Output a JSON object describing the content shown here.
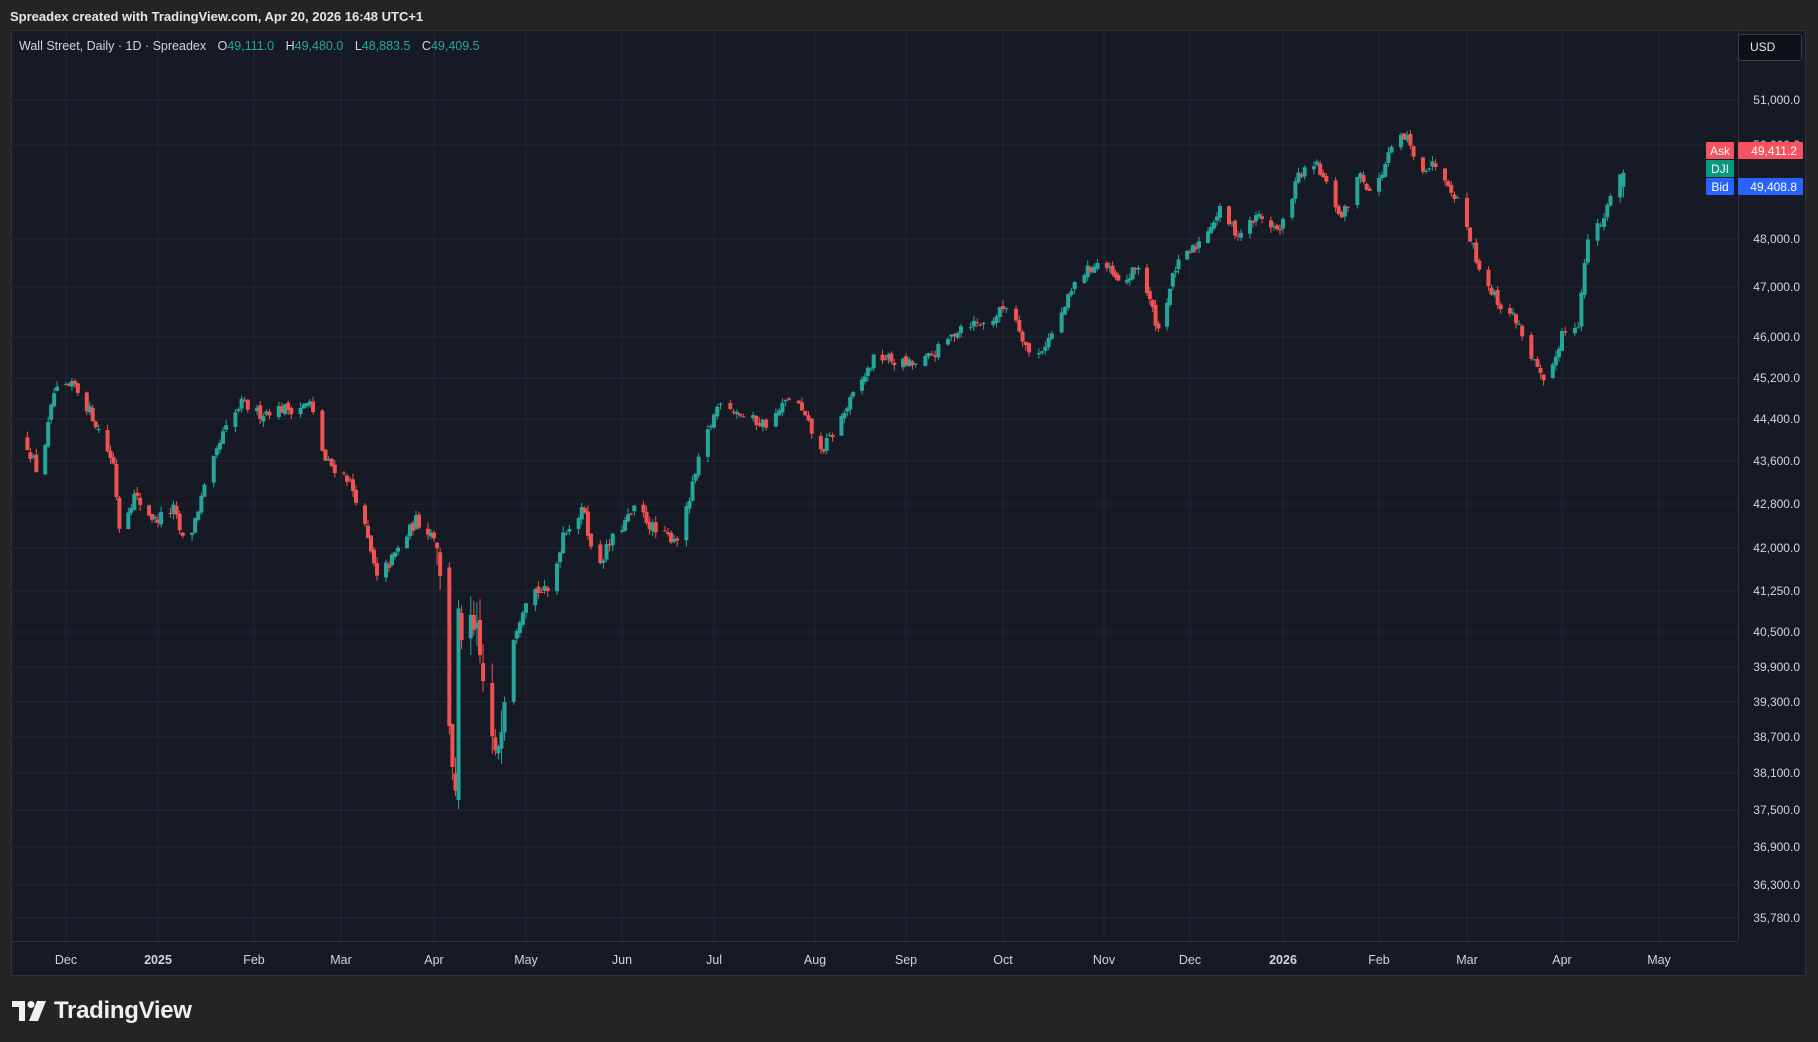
{
  "header": {
    "attribution": "Spreadex created with TradingView.com, Apr 20, 2026 16:48 UTC+1"
  },
  "legend": {
    "symbol": "Wall Street, Daily · 1D · Spreadex",
    "o_label": "O",
    "o_value": "49,111.0",
    "h_label": "H",
    "h_value": "49,480.0",
    "l_label": "L",
    "l_value": "48,883.5",
    "c_label": "C",
    "c_value": "49,409.5"
  },
  "currency": "USD",
  "footer": {
    "logo_text": "TradingView"
  },
  "colors": {
    "up": "#26a69a",
    "down": "#ef5350",
    "background": "#161a25",
    "grid": "#222633",
    "ask": "#f7525f",
    "bid": "#2962ff"
  },
  "chart_data": {
    "type": "candlestick",
    "price_labels": [
      {
        "label": "Ask",
        "value": "49,411.2",
        "color": "#f7525f"
      },
      {
        "label": "DJI",
        "value": "",
        "color": "#089981"
      },
      {
        "label": "Bid",
        "value": "49,408.8",
        "color": "#2962ff"
      }
    ],
    "y_ticks": [
      {
        "v": 51000,
        "t": "51,000.0"
      },
      {
        "v": 50000,
        "t": "50,000.0"
      },
      {
        "v": 48000,
        "t": "48,000.0"
      },
      {
        "v": 47000,
        "t": "47,000.0"
      },
      {
        "v": 46000,
        "t": "46,000.0"
      },
      {
        "v": 45200,
        "t": "45,200.0"
      },
      {
        "v": 44400,
        "t": "44,400.0"
      },
      {
        "v": 43600,
        "t": "43,600.0"
      },
      {
        "v": 42800,
        "t": "42,800.0"
      },
      {
        "v": 42000,
        "t": "42,000.0"
      },
      {
        "v": 41250,
        "t": "41,250.0"
      },
      {
        "v": 40500,
        "t": "40,500.0"
      },
      {
        "v": 39900,
        "t": "39,900.0"
      },
      {
        "v": 39300,
        "t": "39,300.0"
      },
      {
        "v": 38700,
        "t": "38,700.0"
      },
      {
        "v": 38100,
        "t": "38,100.0"
      },
      {
        "v": 37500,
        "t": "37,500.0"
      },
      {
        "v": 36900,
        "t": "36,900.0"
      },
      {
        "v": 36300,
        "t": "36,300.0"
      },
      {
        "v": 35780,
        "t": "35,780.0"
      }
    ],
    "x_ticks": [
      {
        "date": "2024-12-01",
        "t": "Dec",
        "bold": false
      },
      {
        "date": "2025-01-01",
        "t": "2025",
        "bold": true
      },
      {
        "date": "2025-02-01",
        "t": "Feb",
        "bold": false
      },
      {
        "date": "2025-03-01",
        "t": "Mar",
        "bold": false
      },
      {
        "date": "2025-04-01",
        "t": "Apr",
        "bold": false
      },
      {
        "date": "2025-05-01",
        "t": "May",
        "bold": false
      },
      {
        "date": "2025-06-01",
        "t": "Jun",
        "bold": false
      },
      {
        "date": "2025-07-01",
        "t": "Jul",
        "bold": false
      },
      {
        "date": "2025-08-01",
        "t": "Aug",
        "bold": false
      },
      {
        "date": "2025-09-01",
        "t": "Sep",
        "bold": false
      },
      {
        "date": "2025-10-01",
        "t": "Oct",
        "bold": false
      },
      {
        "date": "2025-11-01",
        "t": "Nov",
        "bold": false
      },
      {
        "date": "2025-12-01",
        "t": "Dec",
        "bold": false
      },
      {
        "date": "2026-01-01",
        "t": "2026",
        "bold": true
      },
      {
        "date": "2026-02-01",
        "t": "Feb",
        "bold": false
      },
      {
        "date": "2026-03-01",
        "t": "Mar",
        "bold": false
      },
      {
        "date": "2026-04-01",
        "t": "Apr",
        "bold": false
      },
      {
        "date": "2026-05-01",
        "t": "May",
        "bold": false
      }
    ],
    "close_path": [
      [
        "2024-11-18",
        43900
      ],
      [
        "2024-11-22",
        43300
      ],
      [
        "2024-11-27",
        44900
      ],
      [
        "2024-12-04",
        45050
      ],
      [
        "2024-12-10",
        44450
      ],
      [
        "2024-12-17",
        43550
      ],
      [
        "2024-12-19",
        42400
      ],
      [
        "2024-12-24",
        42950
      ],
      [
        "2024-12-31",
        42500
      ],
      [
        "2025-01-06",
        42700
      ],
      [
        "2025-01-10",
        41950
      ],
      [
        "2025-01-15",
        42900
      ],
      [
        "2025-01-22",
        44100
      ],
      [
        "2025-01-28",
        44700
      ],
      [
        "2025-02-03",
        44500
      ],
      [
        "2025-02-07",
        44600
      ],
      [
        "2025-02-14",
        44600
      ],
      [
        "2025-02-19",
        44700
      ],
      [
        "2025-02-24",
        43600
      ],
      [
        "2025-03-03",
        43300
      ],
      [
        "2025-03-07",
        42800
      ],
      [
        "2025-03-13",
        41450
      ],
      [
        "2025-03-18",
        41800
      ],
      [
        "2025-03-26",
        42500
      ],
      [
        "2025-04-02",
        42200
      ],
      [
        "2025-04-04",
        40550
      ],
      [
        "2025-04-08",
        37600
      ],
      [
        "2025-04-09",
        40600
      ],
      [
        "2025-04-15",
        40350
      ],
      [
        "2025-04-21",
        38200
      ],
      [
        "2025-04-25",
        40100
      ],
      [
        "2025-05-02",
        41300
      ],
      [
        "2025-05-09",
        41200
      ],
      [
        "2025-05-13",
        42300
      ],
      [
        "2025-05-20",
        42700
      ],
      [
        "2025-05-23",
        41600
      ],
      [
        "2025-05-30",
        42250
      ],
      [
        "2025-06-06",
        42750
      ],
      [
        "2025-06-13",
        42200
      ],
      [
        "2025-06-20",
        42200
      ],
      [
        "2025-06-27",
        43800
      ],
      [
        "2025-07-03",
        44800
      ],
      [
        "2025-07-11",
        44400
      ],
      [
        "2025-07-18",
        44300
      ],
      [
        "2025-07-25",
        44900
      ],
      [
        "2025-07-31",
        44150
      ],
      [
        "2025-08-01",
        43600
      ],
      [
        "2025-08-08",
        44200
      ],
      [
        "2025-08-15",
        44950
      ],
      [
        "2025-08-22",
        45650
      ],
      [
        "2025-08-29",
        45500
      ],
      [
        "2025-09-05",
        45450
      ],
      [
        "2025-09-12",
        45800
      ],
      [
        "2025-09-19",
        46300
      ],
      [
        "2025-09-26",
        46250
      ],
      [
        "2025-10-03",
        46700
      ],
      [
        "2025-10-10",
        45500
      ],
      [
        "2025-10-17",
        46150
      ],
      [
        "2025-10-24",
        47200
      ],
      [
        "2025-10-31",
        47550
      ],
      [
        "2025-11-07",
        47000
      ],
      [
        "2025-11-13",
        47450
      ],
      [
        "2025-11-20",
        46150
      ],
      [
        "2025-11-26",
        47400
      ],
      [
        "2025-12-03",
        47850
      ],
      [
        "2025-12-11",
        48600
      ],
      [
        "2025-12-17",
        48100
      ],
      [
        "2025-12-24",
        48500
      ],
      [
        "2025-12-31",
        48150
      ],
      [
        "2026-01-06",
        49350
      ],
      [
        "2026-01-12",
        49550
      ],
      [
        "2026-01-20",
        48450
      ],
      [
        "2026-01-26",
        49400
      ],
      [
        "2026-01-30",
        48900
      ],
      [
        "2026-02-06",
        50100
      ],
      [
        "2026-02-10",
        50150
      ],
      [
        "2026-02-13",
        49500
      ],
      [
        "2026-02-20",
        49600
      ],
      [
        "2026-02-27",
        48700
      ],
      [
        "2026-03-05",
        47400
      ],
      [
        "2026-03-11",
        46700
      ],
      [
        "2026-03-17",
        46350
      ],
      [
        "2026-03-24",
        45350
      ],
      [
        "2026-03-27",
        44900
      ],
      [
        "2026-04-01",
        46100
      ],
      [
        "2026-04-06",
        46300
      ],
      [
        "2026-04-09",
        48000
      ],
      [
        "2026-04-14",
        48400
      ],
      [
        "2026-04-17",
        49300
      ],
      [
        "2026-04-20",
        49409.5
      ]
    ]
  }
}
